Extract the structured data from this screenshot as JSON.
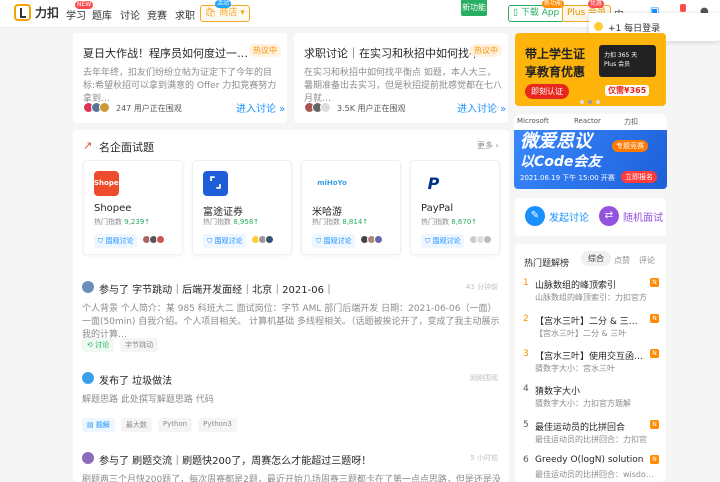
{
  "nav": {
    "logo_text": "力扣",
    "links": [
      "学习",
      "题库",
      "讨论",
      "竞赛",
      "求职"
    ],
    "new_badge": "NEW",
    "shop_label": "商店",
    "shop_badge": "活动",
    "new_feature": "新功能",
    "app_label": "下载 App",
    "app_badge": "新功能",
    "plus_label": "Plus 会员",
    "plus_badge": "优惠",
    "lang": "中",
    "checkin": "+1 每日登录"
  },
  "top_cards": [
    {
      "title": "夏日大作战！程序员如何度过一…",
      "badge": "热议中",
      "desc": "去年年终，扣友们纷纷立帖为证定下了今年的目标:希望秋招可以拿到满意的 Offer 力扣竞赛努力拿到…",
      "watch": "247 用户正在围观",
      "join": "进入讨论 »"
    },
    {
      "title": "求职讨论｜在实习和秋招中如何找平…",
      "badge": "热议中",
      "desc": "在实习和秋招中如何找平衡点 如题，本人大三，暑期准备出去实习，但是秋招提前批感觉都在七八月就…",
      "watch": "3.5K 用户正在围观",
      "join": "进入讨论 »"
    }
  ],
  "banner1": {
    "line1": "带上学生证",
    "line2": "享教育优惠",
    "button": "即刻认证",
    "card_text": "力扣 365 天 Plus 会员",
    "price": "仅需¥365"
  },
  "banner2": {
    "brand1": "Microsoft",
    "brand2": "Reactor",
    "brand3": "力扣",
    "title": "微爱思议",
    "title2": "以Code会友",
    "pill": "专题竞赛",
    "date": "2021.06.19 下午 15:00 开赛",
    "button": "立即报名"
  },
  "quick": {
    "discuss": "发起讨论",
    "mock": "随机面试"
  },
  "hot_list": {
    "title": "热门题解榜",
    "tabs": [
      "综合",
      "点赞",
      "评论"
    ],
    "items": [
      {
        "num": "1",
        "title": "山脉数组的峰顶索引",
        "sub": "山脉数组的峰顶索引：力扣官方",
        "badge": "N"
      },
      {
        "num": "2",
        "title": "【宫水三叶】二分 & 三…",
        "sub": "【宫水三叶】二分 & 三叶",
        "badge": "N"
      },
      {
        "num": "3",
        "title": "【宫水三叶】使用交互函…",
        "sub": "猜数字大小：宫水三叶",
        "badge": "N"
      },
      {
        "num": "4",
        "title": "猜数字大小",
        "sub": "猜数字大小：力扣官方题解",
        "badge": ""
      },
      {
        "num": "5",
        "title": "最佳运动员的比拼回合",
        "sub": "最佳运动员的比拼回合：力扣官",
        "badge": "N"
      },
      {
        "num": "6",
        "title": "Greedy O(logN) solution",
        "sub": "最佳运动员的比拼回合：wisdo…",
        "badge": "N"
      }
    ]
  },
  "companies": {
    "title": "名企面试题",
    "more": "更多 ›",
    "heat_label": "热门指数",
    "button": "围观讨论",
    "items": [
      {
        "name": "Shopee",
        "logo": "Shopee",
        "heat": "9,239↑",
        "color": "#ee4d2d"
      },
      {
        "name": "富途证券",
        "logo": "",
        "heat": "8,958↑",
        "color": "#1e5fd9"
      },
      {
        "name": "米哈游",
        "logo": "miHoYo",
        "heat": "8,814↑",
        "color": "#ffffff"
      },
      {
        "name": "PayPal",
        "logo": "P",
        "heat": "8,670↑",
        "color": "#ffffff"
      }
    ]
  },
  "posts": [
    {
      "title": "参与了 字节跳动｜后端开发面经｜北京｜2021-06｜",
      "meta": "43 分钟前",
      "desc": "个人背景 个人简介：某 985 科班大二 面试岗位：字节 AML 部门后端开发 日期：2021-06-06（一面） 一面(50min) 自我介绍。个人项目相关。 计算机基础 多线程相关。（话题被挨论开了，变成了我主动展示我的计算…",
      "tags": [
        "讨论",
        "字节跳动"
      ]
    },
    {
      "title": "发布了 垃圾做法",
      "meta": "刚刚围观",
      "desc": "解题思路 此处撰写解题思路 代码",
      "tags": [
        "题解",
        "最大数",
        "Python",
        "Python3"
      ]
    },
    {
      "title": "参与了 刷题交流｜刷题快200了，周赛怎么才能超过三题呀！",
      "meta": "5 小时前",
      "desc": "刷题两三个月快200题了，每次周赛都是2题，最近开始几场周赛三题都卡在了第一点点思路，但是还是没写出来…",
      "tags": []
    }
  ]
}
